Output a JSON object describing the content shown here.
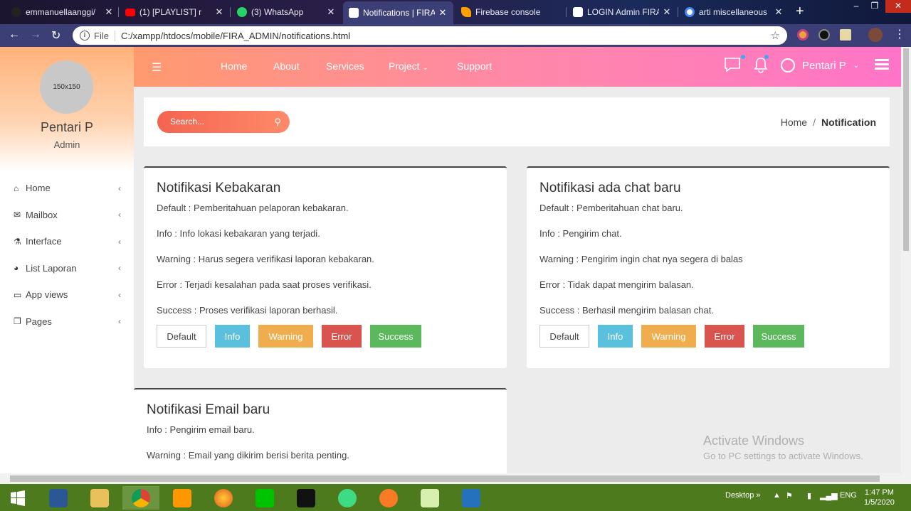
{
  "browser": {
    "tabs": [
      {
        "label": "emmanuellaanggi/",
        "icon_color": "#222222"
      },
      {
        "label": "(1) [PLAYLIST] r",
        "icon_color": "#ff0000"
      },
      {
        "label": "(3) WhatsApp",
        "icon_color": "#25d366"
      },
      {
        "label": "Notifications | FIRA",
        "icon_color": "#ffffff"
      },
      {
        "label": "Firebase console",
        "icon_color": "#ffa000"
      },
      {
        "label": "LOGIN Admin FIRA",
        "icon_color": "#ffffff"
      },
      {
        "label": "arti miscellaneous",
        "icon_color": "#4285f4"
      }
    ],
    "address_prefix": "File",
    "url": "C:/xampp/htdocs/mobile/FIRA_ADMIN/notifications.html"
  },
  "sidebar": {
    "avatar_text": "150x150",
    "user_name": "Pentari P",
    "user_role": "Admin",
    "items": [
      {
        "label": "Home",
        "icon": "home-icon"
      },
      {
        "label": "Mailbox",
        "icon": "envelope-icon"
      },
      {
        "label": "Interface",
        "icon": "flask-icon"
      },
      {
        "label": "List Laporan",
        "icon": "pie-chart-icon"
      },
      {
        "label": "App views",
        "icon": "monitor-icon"
      },
      {
        "label": "Pages",
        "icon": "pages-icon"
      }
    ]
  },
  "topbar": {
    "nav": [
      "Home",
      "About",
      "Services",
      "Project",
      "Support"
    ],
    "user_name": "Pentari P"
  },
  "search": {
    "placeholder": "Search..."
  },
  "breadcrumb": {
    "home": "Home",
    "sep": "/",
    "current": "Notification"
  },
  "cards": [
    {
      "title": "Notifikasi Kebakaran",
      "lines": [
        "Default : Pemberitahuan pelaporan kebakaran.",
        "Info : Info lokasi kebakaran yang terjadi.",
        "Warning : Harus segera verifikasi laporan kebakaran.",
        "Error : Terjadi kesalahan pada saat proses verifikasi.",
        "Success : Proses verifikasi laporan berhasil."
      ],
      "buttons": [
        "Default",
        "Info",
        "Warning",
        "Error",
        "Success"
      ]
    },
    {
      "title": "Notifikasi ada chat baru",
      "lines": [
        "Default : Pemberitahuan chat baru.",
        "Info : Pengirim chat.",
        "Warning : Pengirim ingin chat nya segera di balas",
        "Error : Tidak dapat mengirim balasan.",
        "Success : Berhasil mengirim balasan chat."
      ],
      "buttons": [
        "Default",
        "Info",
        "Warning",
        "Error",
        "Success"
      ]
    },
    {
      "title": "Notifikasi Email baru",
      "lines": [
        "Info : Pengirim email baru.",
        "Warning : Email yang dikirim berisi berita penting."
      ]
    }
  ],
  "watermark": {
    "line1": "Activate Windows",
    "line2": "Go to PC settings to activate Windows."
  },
  "taskbar": {
    "desktop_label": "Desktop",
    "lang": "ENG",
    "time": "1:47 PM",
    "date": "1/5/2020"
  },
  "colors": {
    "sidebar_header": "#ffb27a",
    "topbar_start": "#ff9a6e",
    "topbar_end": "#ff74c8",
    "search": "#f3644f"
  }
}
